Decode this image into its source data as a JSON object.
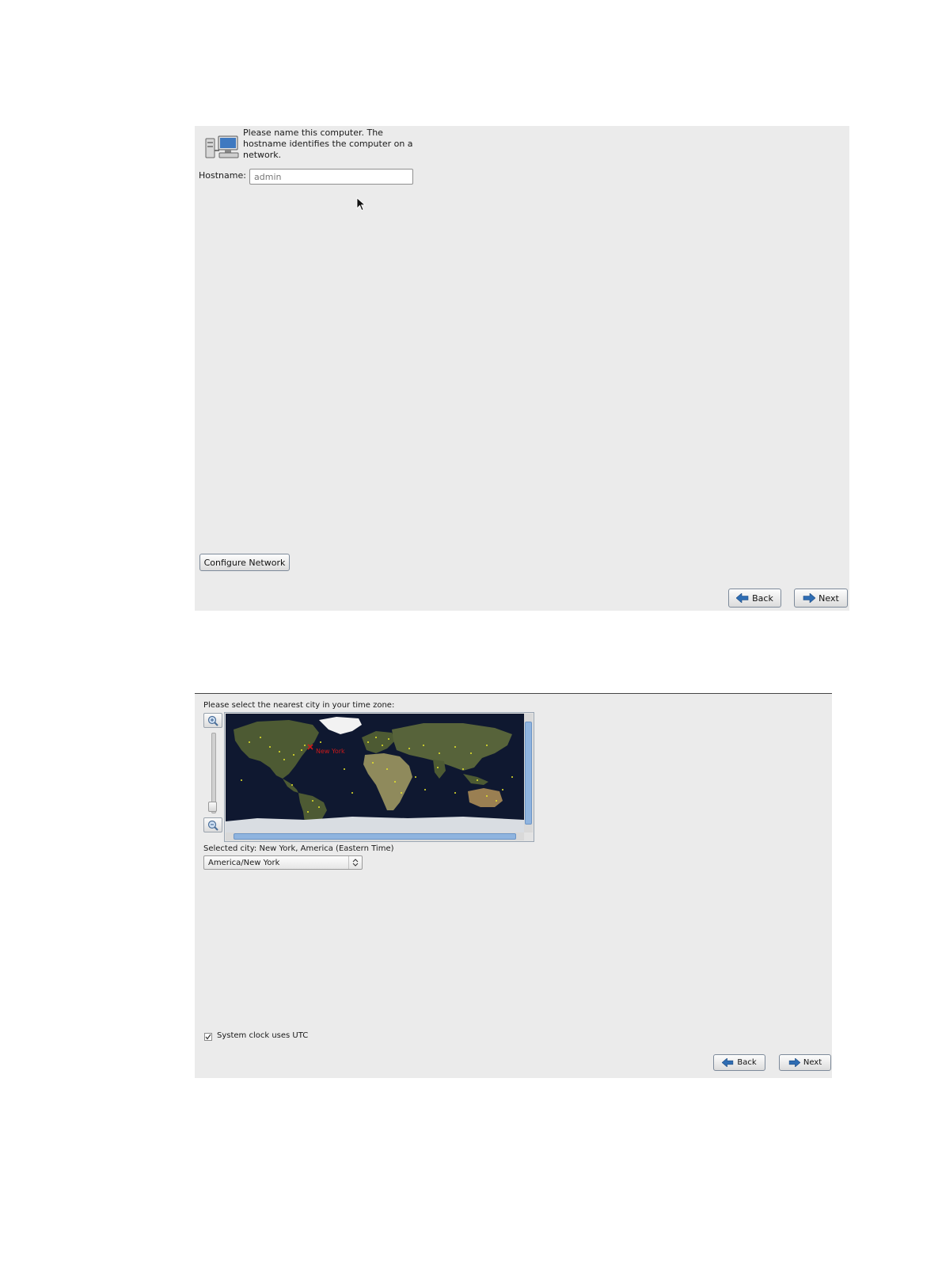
{
  "hostname_screen": {
    "description": "Please name this computer.  The hostname identifies the computer on a network.",
    "hostname_label": "Hostname:",
    "hostname_value": "admin",
    "configure_network_label": "Configure Network",
    "back_label": "Back",
    "next_label": "Next"
  },
  "timezone_screen": {
    "prompt": "Please select the nearest city in your time zone:",
    "map_marker_label": "New York",
    "selected_city_text": "Selected city: New York, America (Eastern Time)",
    "timezone_select_value": "America/New York",
    "utc_checkbox_checked": true,
    "utc_label": "System clock uses UTC",
    "back_label": "Back",
    "next_label": "Next"
  },
  "colors": {
    "panel_background": "#ebebeb",
    "ocean": "#0f1830",
    "land": "#4d5a33",
    "city_dots": "#e8e82a",
    "marker": "#cc1a1a",
    "scrollbar": "#8fb4df",
    "button_arrow": "#2f6db3"
  },
  "icons": [
    "network-computer-icon",
    "mouse-pointer-icon",
    "back-arrow-icon",
    "next-arrow-icon",
    "zoom-in-icon",
    "zoom-out-icon",
    "chevron-updown-icon",
    "checkmark-icon"
  ]
}
